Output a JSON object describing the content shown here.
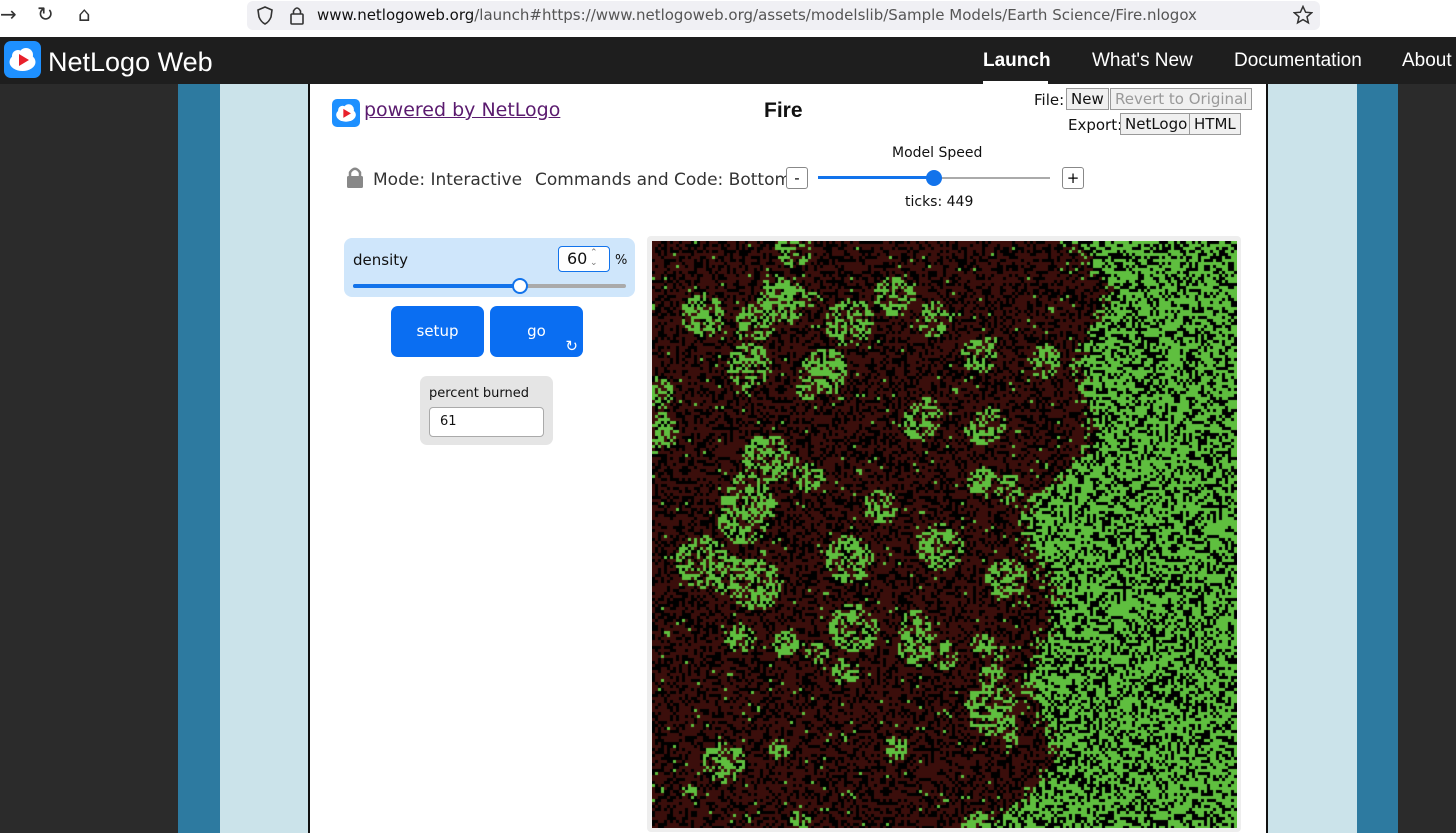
{
  "browser": {
    "back_icon": "back-arrow-icon",
    "reload_icon": "reload-icon",
    "home_icon": "home-icon",
    "url_host": "www.netlogoweb.org",
    "url_path": "/launch#https://www.netlogoweb.org/assets/modelslib/Sample Models/Earth Science/Fire.nlogox"
  },
  "nav": {
    "title": "NetLogo Web",
    "links": [
      "Launch",
      "What's New",
      "Documentation",
      "About"
    ],
    "active": "Launch"
  },
  "model": {
    "powered_by": "powered by NetLogo",
    "title": "Fire",
    "file_label": "File:",
    "file_new": "New",
    "file_revert": "Revert to Original",
    "export_label": "Export:",
    "export_netlogo": "NetLogo",
    "export_html": "HTML",
    "mode_label": "Mode: Interactive",
    "commands_label": "Commands and Code: Bottom",
    "speed_label": "Model Speed",
    "speed_minus": "-",
    "speed_plus": "+",
    "speed_value": 0.5,
    "ticks_label": "ticks: 449"
  },
  "widgets": {
    "density": {
      "label": "density",
      "value": "60",
      "unit": "%",
      "min": 0,
      "max": 99,
      "fraction": 0.61
    },
    "setup_label": "setup",
    "go_label": "go",
    "monitor": {
      "label": "percent burned",
      "value": "61"
    }
  },
  "world": {
    "colors": {
      "burned": "#3b0e0b",
      "empty": "#000000",
      "tree": "#5fbf3f"
    },
    "burned_fraction": 0.61
  },
  "page_colors": {
    "outer_band": "#2d7aa0",
    "inner_band": "#cbe3ea",
    "accent": "#0a6ef2"
  }
}
